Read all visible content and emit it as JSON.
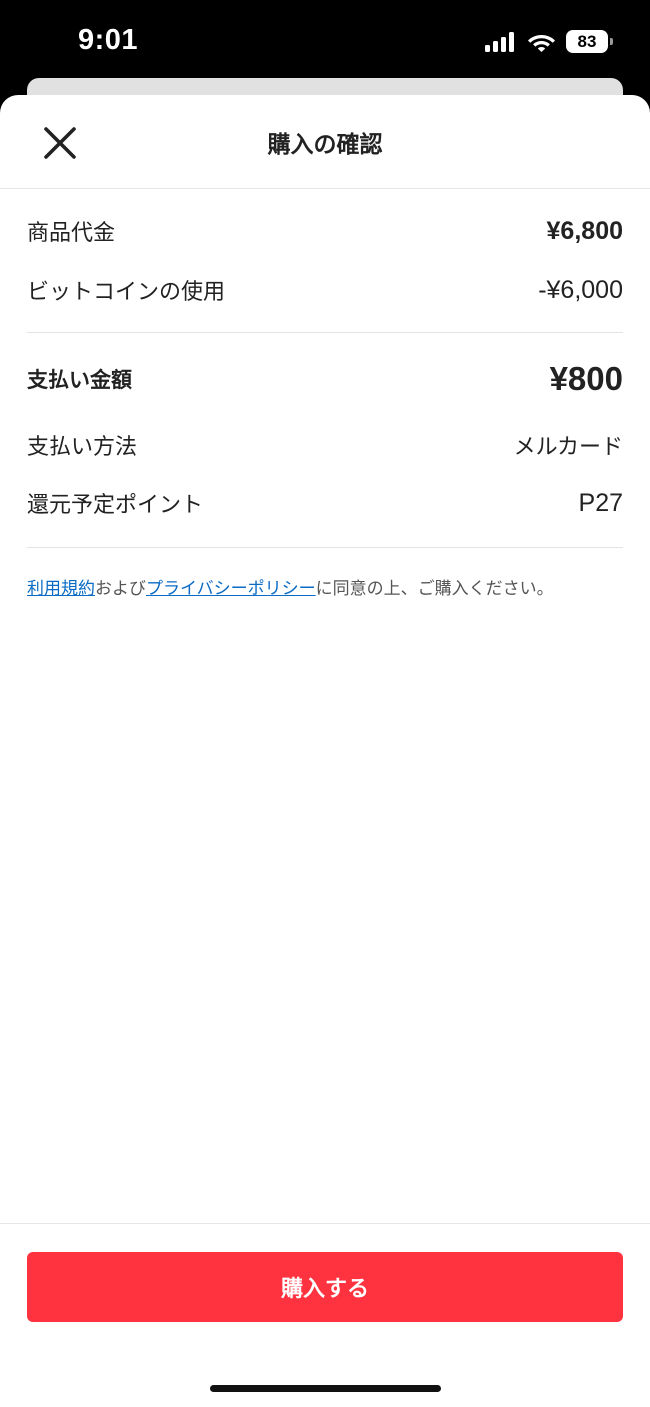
{
  "status_bar": {
    "time": "9:01",
    "battery": "83"
  },
  "header": {
    "title": "購入の確認"
  },
  "summary": {
    "item_price_label": "商品代金",
    "item_price_value": "¥6,800",
    "bitcoin_label": "ビットコインの使用",
    "bitcoin_value": "-¥6,000"
  },
  "payment": {
    "total_label": "支払い金額",
    "total_value": "¥800",
    "method_label": "支払い方法",
    "method_value": "メルカード",
    "points_label": "還元予定ポイント",
    "points_value": "P27"
  },
  "consent": {
    "terms_link": "利用規約",
    "and": "および",
    "privacy_link": "プライバシーポリシー",
    "rest": "に同意の上、ご購入ください。"
  },
  "footer": {
    "buy_label": "購入する"
  },
  "colors": {
    "accent": "#ff333f",
    "link": "#0a6bc4"
  }
}
